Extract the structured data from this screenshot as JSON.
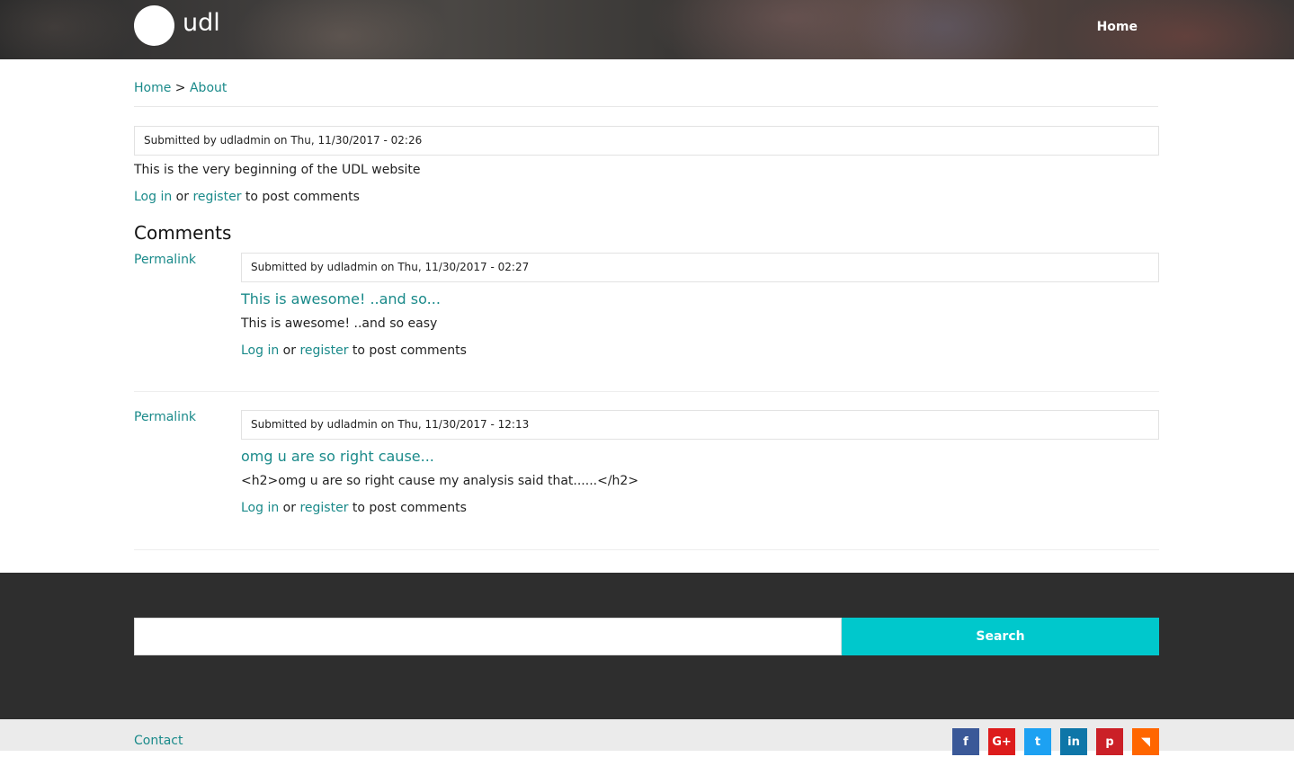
{
  "header": {
    "site_name": "udl",
    "nav": [
      {
        "label": "Home"
      }
    ]
  },
  "breadcrumb": {
    "items": [
      "Home",
      "About"
    ],
    "separator": ">"
  },
  "node": {
    "submitted": "Submitted by udladmin on Thu, 11/30/2017 - 02:26",
    "body": "This is the very beginning of the UDL website",
    "login_label": "Log in",
    "or_text": "or",
    "register_label": "register",
    "post_text": "to post comments"
  },
  "comments": {
    "title": "Comments",
    "items": [
      {
        "permalink": "Permalink",
        "submitted": "Submitted by udladmin on Thu, 11/30/2017 - 02:27",
        "title": "This is awesome! ..and so...",
        "body": "This is awesome! ..and so easy",
        "login_label": "Log in",
        "or_text": "or",
        "register_label": "register",
        "post_text": "to post comments"
      },
      {
        "permalink": "Permalink",
        "submitted": "Submitted by udladmin on Thu, 11/30/2017 - 12:13",
        "title": "omg u are so right cause...",
        "body": "<h2>omg u are so right cause my analysis said that......</h2>",
        "login_label": "Log in",
        "or_text": "or",
        "register_label": "register",
        "post_text": "to post comments"
      }
    ]
  },
  "search": {
    "value": "",
    "button_label": "Search"
  },
  "footer": {
    "contact_label": "Contact",
    "social": [
      {
        "icon": "facebook-icon",
        "glyph": "f",
        "color": "#3b5998"
      },
      {
        "icon": "google-plus-icon",
        "glyph": "G+",
        "color": "#dd1c1c"
      },
      {
        "icon": "twitter-icon",
        "glyph": "t",
        "color": "#1da1f2"
      },
      {
        "icon": "linkedin-icon",
        "glyph": "in",
        "color": "#0e76a8"
      },
      {
        "icon": "pinterest-icon",
        "glyph": "p",
        "color": "#cb2027"
      },
      {
        "icon": "rss-icon",
        "glyph": "◥",
        "color": "#ff6600"
      }
    ]
  },
  "colors": {
    "link": "#1a8a8a",
    "search_button": "#00c8cc",
    "footer_dark": "#2e2e2e",
    "footer_light": "#ebebeb"
  }
}
